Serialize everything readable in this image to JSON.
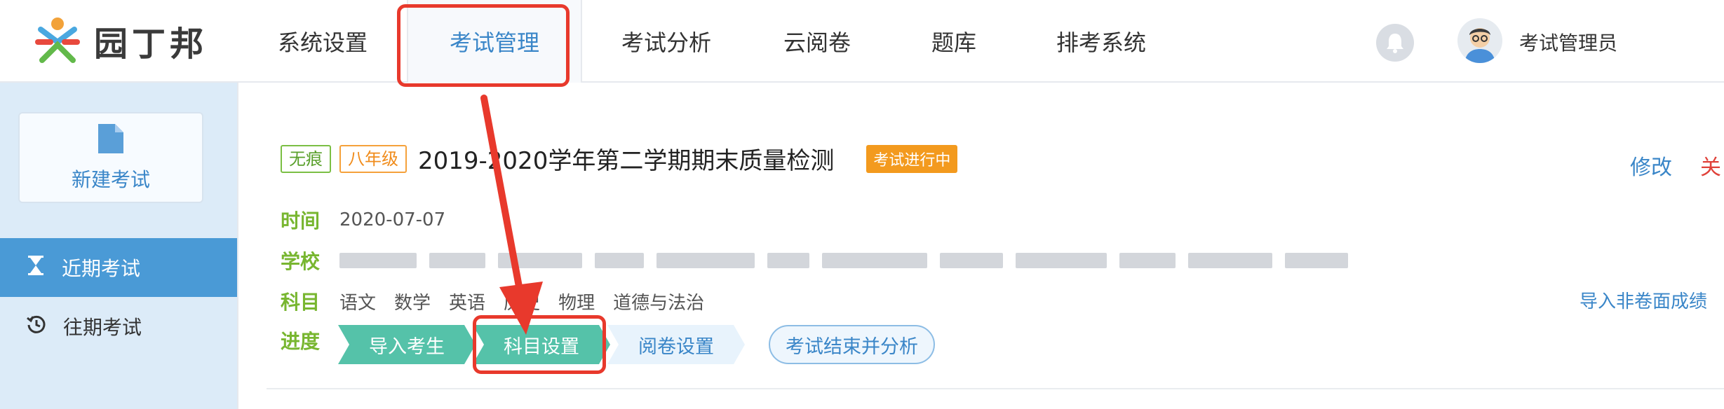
{
  "app": {
    "logo_text": "园丁邦"
  },
  "nav": {
    "items": [
      {
        "label": "系统设置"
      },
      {
        "label": "考试管理"
      },
      {
        "label": "考试分析"
      },
      {
        "label": "云阅卷"
      },
      {
        "label": "题库"
      },
      {
        "label": "排考系统"
      }
    ],
    "active_index": 1
  },
  "user": {
    "name": "考试管理员"
  },
  "sidebar": {
    "new_exam_label": "新建考试",
    "items": [
      {
        "label": "近期考试",
        "icon": "hourglass-icon",
        "active": true
      },
      {
        "label": "往期考试",
        "icon": "history-icon",
        "active": false
      }
    ]
  },
  "exam": {
    "tags": [
      "无痕",
      "八年级"
    ],
    "title": "2019-2020学年第二学期期末质量检测",
    "status": "考试进行中",
    "actions": {
      "edit": "修改",
      "close": "关"
    },
    "time_label": "时间",
    "time_value": "2020-07-07",
    "school_label": "学校",
    "subject_label": "科目",
    "subjects": [
      "语文",
      "数学",
      "英语",
      "历史",
      "物理",
      "道德与法治"
    ],
    "import_link": "导入非卷面成绩",
    "progress_label": "进度",
    "steps": [
      {
        "label": "导入考生",
        "state": "done"
      },
      {
        "label": "科目设置",
        "state": "done"
      },
      {
        "label": "阅卷设置",
        "state": "todo"
      },
      {
        "label": "考试结束并分析",
        "state": "final"
      }
    ]
  },
  "colors": {
    "accent": "#3a86c8",
    "step_done": "#55c2a9",
    "status": "#f39a1e",
    "label_green": "#78b630",
    "highlight_red": "#e8392c"
  }
}
